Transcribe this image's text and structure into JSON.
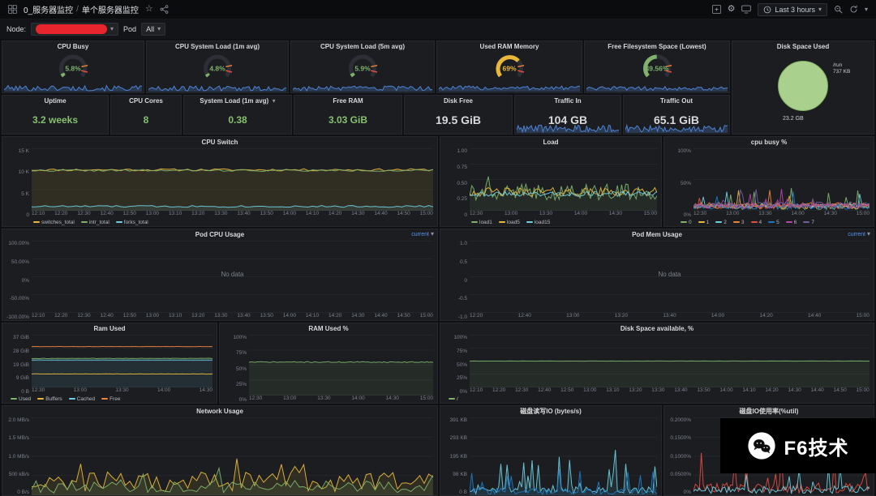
{
  "icons": {
    "star": "☆",
    "gear": "⚙",
    "caret": "▾"
  },
  "topbar": {
    "breadcrumb_dashboard": "0_服务器监控",
    "breadcrumb_sep": "/",
    "breadcrumb_page": "单个服务器监控",
    "time_range": "Last 3 hours"
  },
  "varbar": {
    "node_label": "Node:",
    "pod_label": "Pod",
    "pod_value": "All"
  },
  "axes": {
    "times18": [
      "12:10",
      "12:20",
      "12:30",
      "12:40",
      "12:50",
      "13:00",
      "13:10",
      "13:20",
      "13:30",
      "13:40",
      "13:50",
      "14:00",
      "14:10",
      "14:20",
      "14:30",
      "14:40",
      "14:50",
      "15:00"
    ],
    "times9": [
      "12:20",
      "12:40",
      "13:00",
      "13:20",
      "13:40",
      "14:00",
      "14:20",
      "14:40",
      "15:00"
    ],
    "times6": [
      "12:30",
      "13:00",
      "13:30",
      "14:00",
      "14:30",
      "15:00"
    ],
    "times5": [
      "12:30",
      "13:00",
      "13:30",
      "14:00",
      "14:30"
    ]
  },
  "gauges": [
    {
      "title": "CPU Busy",
      "value": "5.8%",
      "pct": 5.8,
      "color": "#7eb26d",
      "spark": {
        "color": "#5794f2",
        "base": 0.32,
        "amp": 0.26,
        "seed": 101,
        "fill": true
      }
    },
    {
      "title": "CPU System Load (1m avg)",
      "value": "4.8%",
      "pct": 4.8,
      "color": "#7eb26d",
      "spark": {
        "color": "#5794f2",
        "base": 0.3,
        "amp": 0.24,
        "seed": 102,
        "fill": true
      }
    },
    {
      "title": "CPU System Load (5m avg)",
      "value": "5.9%",
      "pct": 5.9,
      "color": "#7eb26d",
      "spark": {
        "color": "#5794f2",
        "base": 0.3,
        "amp": 0.22,
        "seed": 103,
        "fill": true
      }
    },
    {
      "title": "Used RAM Memory",
      "value": "69%",
      "pct": 69,
      "color": "#eab839",
      "spark": {
        "color": "#5794f2",
        "base": 0.34,
        "amp": 0.2,
        "seed": 104,
        "fill": true
      }
    },
    {
      "title": "Free Filesystem Space (Lowest)",
      "value": "49.56%",
      "pct": 49.56,
      "color": "#7eb26d",
      "spark": {
        "color": "#5794f2",
        "base": 0.3,
        "amp": 0.2,
        "seed": 105,
        "fill": true
      }
    }
  ],
  "disk_panel": {
    "title": "Disk Space Used",
    "mount_label": "/run",
    "mount_value": "737 KB",
    "total_label": "23.2 GB",
    "pie_color": "#a9d08c"
  },
  "stats": [
    {
      "title": "Uptime",
      "value": "3.2 weeks",
      "color": "#86c06d"
    },
    {
      "title": "CPU Cores",
      "value": "8",
      "color": "#86c06d"
    },
    {
      "title": "System Load (1m avg)",
      "value": "0.38",
      "color": "#86c06d"
    },
    {
      "title": "Free RAM",
      "value": "3.03 GiB",
      "color": "#86c06d"
    },
    {
      "title": "Disk Free",
      "value": "19.5 GiB",
      "color": "#d8d9da"
    },
    {
      "title": "Traffic In",
      "value": "104 GB",
      "color": "#d8d9da",
      "spark": {
        "color": "#5794f2",
        "base": 0.35,
        "amp": 0.28,
        "seed": 106,
        "fill": true
      }
    },
    {
      "title": "Traffic Out",
      "value": "65.1 GiB",
      "color": "#d8d9da",
      "spark": {
        "color": "#5794f2",
        "base": 0.33,
        "amp": 0.26,
        "seed": 107,
        "fill": true
      }
    }
  ],
  "panels": {
    "cpu_switch": {
      "title": "CPU Switch",
      "yticks": [
        "15 K",
        "10 K",
        "5 K",
        "0"
      ],
      "legend": [
        {
          "label": "switches_total",
          "color": "#eab839"
        },
        {
          "label": "intr_total",
          "color": "#7eb26d"
        },
        {
          "label": "forks_total",
          "color": "#6ed0e0"
        }
      ]
    },
    "load": {
      "title": "Load",
      "yticks": [
        "1.00",
        "0.75",
        "0.50",
        "0.25",
        "0"
      ],
      "legend": [
        {
          "label": "load1",
          "color": "#7eb26d"
        },
        {
          "label": "load5",
          "color": "#eab839"
        },
        {
          "label": "load15",
          "color": "#6ed0e0"
        }
      ]
    },
    "cpu_busy_pct": {
      "title": "cpu busy %",
      "yticks": [
        "100%",
        "50%",
        "0%"
      ],
      "legend": [
        {
          "label": "0",
          "color": "#7eb26d"
        },
        {
          "label": "1",
          "color": "#eab839"
        },
        {
          "label": "2",
          "color": "#6ed0e0"
        },
        {
          "label": "3",
          "color": "#ef843c"
        },
        {
          "label": "4",
          "color": "#e24d42"
        },
        {
          "label": "5",
          "color": "#1f78c1"
        },
        {
          "label": "6",
          "color": "#ba43a9"
        },
        {
          "label": "7",
          "color": "#705da0"
        }
      ]
    },
    "pod_cpu": {
      "title": "Pod CPU Usage",
      "link": "current",
      "no_data": "No data",
      "yticks": [
        "100.00%",
        "50.00%",
        "0%",
        "-50.00%",
        "-100.00%"
      ]
    },
    "pod_mem": {
      "title": "Pod Mem Usage",
      "link": "current",
      "no_data": "No data",
      "yticks": [
        "1.0",
        "0.5",
        "0",
        "-0.5",
        "-1.0"
      ]
    },
    "ram_used": {
      "title": "Ram Used",
      "yticks": [
        "37 GiB",
        "28 GiB",
        "19 GiB",
        "9 GiB",
        "0 B"
      ],
      "legend": [
        {
          "label": "Used",
          "color": "#7eb26d"
        },
        {
          "label": "Buffers",
          "color": "#eab839"
        },
        {
          "label": "Cached",
          "color": "#6ed0e0"
        },
        {
          "label": "Free",
          "color": "#ef843c"
        }
      ]
    },
    "ram_pct": {
      "title": "RAM Used %",
      "yticks": [
        "100%",
        "75%",
        "50%",
        "25%",
        "0%"
      ]
    },
    "disk_avail": {
      "title": "Disk Space available, %",
      "yticks": [
        "100%",
        "75%",
        "50%",
        "25%",
        "0%"
      ],
      "legend": [
        {
          "label": "/",
          "color": "#7eb26d"
        }
      ]
    },
    "network": {
      "title": "Network Usage",
      "yticks": [
        "2.0 MB/s",
        "1.5 MB/s",
        "1.0 MB/s",
        "500 kB/s",
        "0 B/s"
      ]
    },
    "disk_io": {
      "title": "磁盘读写IO (bytes/s)",
      "yticks": [
        "391 KB",
        "293 KB",
        "195 KB",
        "98 KB",
        "0 B"
      ]
    },
    "disk_util": {
      "title": "磁盘IO使用率(%util)",
      "yticks": [
        "0.2000%",
        "0.1500%",
        "0.1000%",
        "0.0500%",
        "0%"
      ]
    }
  },
  "charts": {
    "cpu_switch": {
      "grid": 3,
      "series": [
        {
          "color": "#eab839",
          "base": 0.655,
          "amp": 0.018,
          "seed": 11,
          "fill": true
        },
        {
          "color": "#7eb26d",
          "base": 0.645,
          "amp": 0.015,
          "seed": 22
        },
        {
          "color": "#6ed0e0",
          "base": 0.07,
          "amp": 0.015,
          "seed": 33,
          "fill": true
        }
      ]
    },
    "load": {
      "grid": 4,
      "series": [
        {
          "color": "#7eb26d",
          "base": 0.3,
          "amp": 0.13,
          "seed": 41,
          "fill": true,
          "spike": 0.05,
          "spikeAmp": 0.25
        },
        {
          "color": "#eab839",
          "base": 0.3,
          "amp": 0.07,
          "seed": 42
        },
        {
          "color": "#6ed0e0",
          "base": 0.27,
          "amp": 0.04,
          "seed": 43
        }
      ]
    },
    "cpu_busy_pct": {
      "grid": 2,
      "series": [
        {
          "color": "#7eb26d",
          "base": 0.06,
          "amp": 0.04,
          "seed": 51,
          "spike": 0.05,
          "spikeAmp": 0.3
        },
        {
          "color": "#eab839",
          "base": 0.07,
          "amp": 0.04,
          "seed": 52,
          "spike": 0.05,
          "spikeAmp": 0.3
        },
        {
          "color": "#6ed0e0",
          "base": 0.08,
          "amp": 0.04,
          "seed": 53,
          "spike": 0.05,
          "spikeAmp": 0.3
        },
        {
          "color": "#ef843c",
          "base": 0.09,
          "amp": 0.04,
          "seed": 54,
          "spike": 0.05,
          "spikeAmp": 0.3
        },
        {
          "color": "#e24d42",
          "base": 0.07,
          "amp": 0.04,
          "seed": 55,
          "spike": 0.05,
          "spikeAmp": 0.35
        },
        {
          "color": "#1f78c1",
          "base": 0.06,
          "amp": 0.04,
          "seed": 56,
          "spike": 0.05,
          "spikeAmp": 0.3
        },
        {
          "color": "#ba43a9",
          "base": 0.08,
          "amp": 0.04,
          "seed": 57,
          "spike": 0.05,
          "spikeAmp": 0.3
        },
        {
          "color": "#705da0",
          "base": 0.1,
          "amp": 0.04,
          "seed": 58,
          "spike": 0.05,
          "spikeAmp": 0.3
        }
      ]
    },
    "pod_cpu": {
      "grid": 4,
      "series": []
    },
    "pod_mem": {
      "grid": 4,
      "series": []
    },
    "ram_used": {
      "grid": 4,
      "series": [
        {
          "color": "#ef843c",
          "base": 0.775,
          "amp": 0.002,
          "seed": 61
        },
        {
          "color": "#6ed0e0",
          "base": 0.52,
          "amp": 0.002,
          "seed": 62,
          "fill": true
        },
        {
          "color": "#eab839",
          "base": 0.255,
          "amp": 0.002,
          "seed": 63
        },
        {
          "color": "#7eb26d",
          "base": 0.55,
          "amp": 0.004,
          "seed": 64
        }
      ]
    },
    "ram_pct": {
      "grid": 4,
      "series": [
        {
          "color": "#7eb26d",
          "base": 0.55,
          "amp": 0.008,
          "seed": 71,
          "fill": true
        }
      ]
    },
    "disk_avail": {
      "grid": 4,
      "series": [
        {
          "color": "#7eb26d",
          "base": 0.5,
          "amp": 0.002,
          "seed": 72,
          "fill": true
        }
      ]
    },
    "network": {
      "grid": 4,
      "series": [
        {
          "color": "#eab839",
          "base": 0.17,
          "amp": 0.13,
          "seed": 81,
          "fill": true,
          "spike": 0.1,
          "spikeAmp": 0.35
        },
        {
          "color": "#7eb26d",
          "base": 0.11,
          "amp": 0.08,
          "seed": 82,
          "fill": true,
          "spike": 0.06,
          "spikeAmp": 0.25
        }
      ]
    },
    "disk_io": {
      "grid": 4,
      "series": [
        {
          "color": "#6ed0e0",
          "base": 0.07,
          "amp": 0.05,
          "seed": 91,
          "fill": true,
          "spike": 0.18,
          "spikeAmp": 0.55
        },
        {
          "color": "#1f78c1",
          "base": 0.05,
          "amp": 0.04,
          "seed": 92,
          "fill": true,
          "spike": 0.1,
          "spikeAmp": 0.3
        }
      ]
    },
    "disk_util": {
      "grid": 4,
      "series": [
        {
          "color": "#e24d42",
          "base": 0.09,
          "amp": 0.07,
          "seed": 95,
          "spike": 0.1,
          "spikeAmp": 0.45
        },
        {
          "color": "#6ed0e0",
          "base": 0.07,
          "amp": 0.05,
          "seed": 96,
          "spike": 0.08,
          "spikeAmp": 0.35
        }
      ]
    }
  },
  "watermark": {
    "brand": "F6技术"
  }
}
